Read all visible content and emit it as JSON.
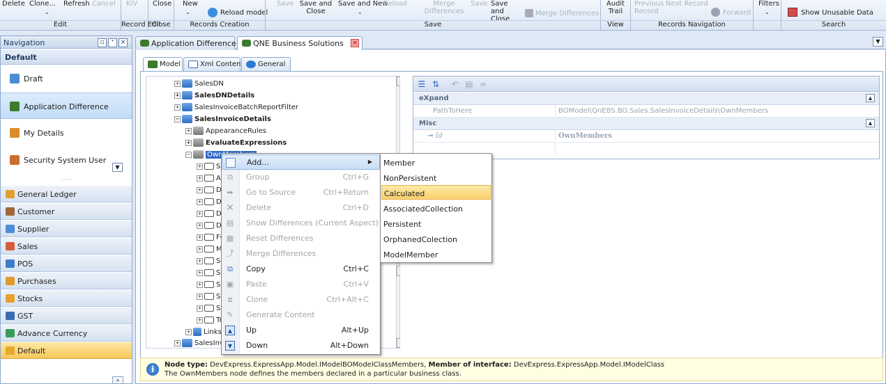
{
  "ribbon": {
    "top_labels": [
      {
        "text": "Delete",
        "disabled": false
      },
      {
        "text": "Clone...",
        "disabled": false
      },
      {
        "text": "Refresh",
        "disabled": false
      },
      {
        "text": "Cancel",
        "disabled": true
      },
      {
        "text": "KIV",
        "disabled": true
      },
      {
        "text": "Close",
        "disabled": false
      },
      {
        "text": "New",
        "disabled": false
      },
      {
        "text": "Reload model",
        "disabled": false
      },
      {
        "text": "Save",
        "disabled": true
      },
      {
        "text": "Save and Close",
        "disabled": false
      },
      {
        "text": "Save and New",
        "disabled": false
      },
      {
        "text": "Reload",
        "disabled": true
      },
      {
        "text": "Merge Differences",
        "disabled": true
      },
      {
        "text": "Save",
        "disabled": true
      },
      {
        "text": "Save and Close",
        "disabled": false
      },
      {
        "text": "Merge Differences",
        "disabled": true
      },
      {
        "text": "Audit Trail",
        "disabled": false
      },
      {
        "text": "Previous Record",
        "disabled": true
      },
      {
        "text": "Next Record",
        "disabled": true
      },
      {
        "text": "Forward",
        "disabled": true
      },
      {
        "text": "Filters",
        "disabled": false
      },
      {
        "text": "Show Unusable Data",
        "disabled": false
      }
    ],
    "groups": [
      "Edit",
      "Record Edit",
      "Close",
      "Records Creation",
      "Save",
      "View",
      "Records Navigation",
      "Search"
    ]
  },
  "navigation": {
    "title": "Navigation",
    "section": "Default",
    "items": [
      {
        "label": "Draft",
        "icon": "draft-icon",
        "color": "#4a8bd4"
      },
      {
        "label": "Application Difference",
        "icon": "application-difference-icon",
        "color": "#3c7a2c"
      },
      {
        "label": "My Details",
        "icon": "my-details-icon",
        "color": "#d98c2b"
      },
      {
        "label": "Security System User",
        "icon": "security-user-icon",
        "color": "#c9702e"
      }
    ],
    "groups": [
      {
        "label": "General Ledger",
        "icon": "general-ledger-icon",
        "color": "#e0a030"
      },
      {
        "label": "Customer",
        "icon": "customer-icon",
        "color": "#a0683a"
      },
      {
        "label": "Supplier",
        "icon": "supplier-icon",
        "color": "#4d8fd6"
      },
      {
        "label": "Sales",
        "icon": "sales-icon",
        "color": "#d65c3c"
      },
      {
        "label": "POS",
        "icon": "pos-icon",
        "color": "#3f7dc8"
      },
      {
        "label": "Purchases",
        "icon": "purchases-icon",
        "color": "#e09a2a"
      },
      {
        "label": "Stocks",
        "icon": "stocks-icon",
        "color": "#e8a030"
      },
      {
        "label": "GST",
        "icon": "gst-icon",
        "color": "#3a6ab0"
      },
      {
        "label": "Advance Currency",
        "icon": "advance-currency-icon",
        "color": "#3a9a5a"
      },
      {
        "label": "Default",
        "icon": "default-folder-icon",
        "color": "#e6a92c",
        "selected": true
      }
    ]
  },
  "doc_tabs": [
    "Application Difference",
    "QNE Business Solutions"
  ],
  "sub_tabs": [
    "Model",
    "Xml Content",
    "General"
  ],
  "tree": [
    {
      "label": "SalesDN",
      "bold": false
    },
    {
      "label": "SalesDNDetails",
      "bold": true
    },
    {
      "label": "SalesInvoiceBatchReportFilter",
      "bold": false
    },
    {
      "label": "SalesInvoiceDetails",
      "bold": true
    },
    {
      "label": "AppearanceRules",
      "bold": false
    },
    {
      "label": "EvaluateExpressions",
      "bold": true
    },
    {
      "label": "OwnMembers",
      "bold": false
    },
    {
      "label": "Sa",
      "bold": false
    },
    {
      "label": "All",
      "bold": false
    },
    {
      "label": "DI",
      "bold": false
    },
    {
      "label": "Dis",
      "bold": false
    },
    {
      "label": "Dis",
      "bold": false
    },
    {
      "label": "Dis",
      "bold": false
    },
    {
      "label": "FC",
      "bold": false
    },
    {
      "label": "MS",
      "bold": false
    },
    {
      "label": "Se",
      "bold": false
    },
    {
      "label": "Se",
      "bold": false
    },
    {
      "label": "Se",
      "bold": false
    },
    {
      "label": "Se",
      "bold": false
    },
    {
      "label": "St",
      "bold": false
    },
    {
      "label": "Tr",
      "bold": false
    },
    {
      "label": "Links",
      "bold": false
    },
    {
      "label": "SalesInvo",
      "bold": false
    },
    {
      "label": "SalesInvo",
      "bold": false
    }
  ],
  "property_grid": {
    "cat_expand": "eXpand",
    "path_key": "PathToHere",
    "path_value": "BOModel\\QnEBS.BO.Sales.SalesInvoiceDetails\\OwnMembers",
    "cat_misc": "Misc",
    "id_key": "Id",
    "id_value": "OwnMembers"
  },
  "info": {
    "node_type_label": "Node type:",
    "node_type_value": "DevExpress.ExpressApp.Model.IModelBOModelClassMembers,",
    "member_label": "Member of interface:",
    "member_value": "DevExpress.ExpressApp.Model.IModelClass",
    "description": "The OwnMembers node defines the members declared in a particular business class."
  },
  "context_menu": [
    {
      "label": "Add...",
      "shortcut": "",
      "disabled": false,
      "hover": true,
      "submenu": true,
      "icon": "add-icon"
    },
    {
      "label": "Group",
      "shortcut": "Ctrl+G",
      "disabled": true,
      "icon": "group-icon"
    },
    {
      "label": "Go to Source",
      "shortcut": "Ctrl+Return",
      "disabled": true,
      "icon": "go-to-source-icon"
    },
    {
      "label": "Delete",
      "shortcut": "Ctrl+D",
      "disabled": true,
      "icon": "delete-icon"
    },
    {
      "label": "Show Differences (Current Aspect)",
      "shortcut": "",
      "disabled": true,
      "icon": "show-differences-icon"
    },
    {
      "label": "Reset Differences",
      "shortcut": "",
      "disabled": true,
      "icon": "reset-differences-icon"
    },
    {
      "label": "Merge Differences",
      "shortcut": "",
      "disabled": true,
      "icon": "merge-differences-icon"
    },
    {
      "label": "Copy",
      "shortcut": "Ctrl+C",
      "disabled": false,
      "icon": "copy-icon"
    },
    {
      "label": "Paste",
      "shortcut": "Ctrl+V",
      "disabled": true,
      "icon": "paste-icon"
    },
    {
      "label": "Clone",
      "shortcut": "Ctrl+Alt+C",
      "disabled": true,
      "icon": "clone-icon"
    },
    {
      "label": "Generate Content",
      "shortcut": "",
      "disabled": true,
      "icon": "generate-content-icon"
    },
    {
      "label": "Up",
      "shortcut": "Alt+Up",
      "disabled": false,
      "icon": "up-icon"
    },
    {
      "label": "Down",
      "shortcut": "Alt+Down",
      "disabled": false,
      "icon": "down-icon"
    }
  ],
  "submenu": [
    "Member",
    "NonPersistent",
    "Calculated",
    "AssociatedCollection",
    "Persistent",
    "OrphanedColection",
    "ModelMember"
  ]
}
